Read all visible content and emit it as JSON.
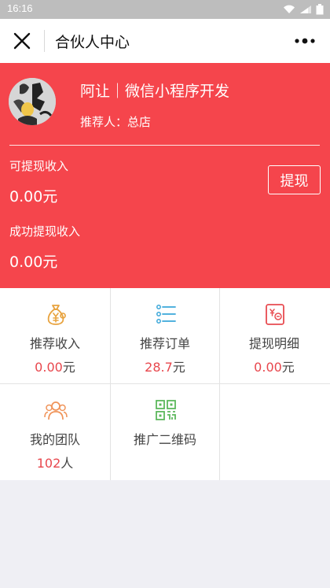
{
  "status_bar": {
    "time": "16:16"
  },
  "nav": {
    "title": "合伙人中心"
  },
  "profile": {
    "name_line": "阿让｜微信小程序开发",
    "referrer": "推荐人：总店",
    "withdrawable_label": "可提现收入",
    "withdrawable_amount": "0.00元",
    "withdrawn_label": "成功提现收入",
    "withdrawn_amount": "0.00元",
    "withdraw_button": "提现"
  },
  "menu": {
    "items": [
      {
        "label": "推荐收入",
        "value": "0.00",
        "unit": "元",
        "icon": "money-bag-icon",
        "color": "#e8a33f"
      },
      {
        "label": "推荐订单",
        "value": "28.7",
        "unit": "元",
        "icon": "list-icon",
        "color": "#3aa7d9"
      },
      {
        "label": "提现明细",
        "value": "0.00",
        "unit": "元",
        "icon": "bill-icon",
        "color": "#e84b50"
      },
      {
        "label": "我的团队",
        "value": "102",
        "unit": "人",
        "icon": "team-icon",
        "color": "#f0945a"
      },
      {
        "label": "推广二维码",
        "icon": "qr-code-icon",
        "color": "#5cb85c"
      }
    ]
  },
  "colors": {
    "accent": "#f5454c",
    "value_red": "#e8474d"
  }
}
